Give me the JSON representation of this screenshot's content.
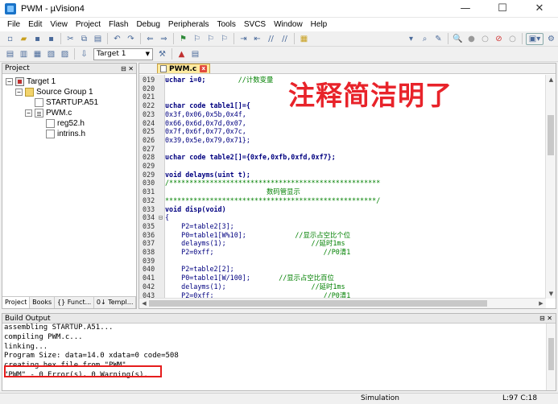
{
  "window": {
    "title": "PWM - µVision4",
    "controls": [
      "—",
      "☐",
      "✕"
    ]
  },
  "menu": [
    "File",
    "Edit",
    "View",
    "Project",
    "Flash",
    "Debug",
    "Peripherals",
    "Tools",
    "SVCS",
    "Window",
    "Help"
  ],
  "toolbar2": {
    "target_select": "Target 1"
  },
  "project_panel": {
    "title": "Project",
    "tree": [
      {
        "label": "Target 1",
        "level": 0,
        "type": "target",
        "expander": "−"
      },
      {
        "label": "Source Group 1",
        "level": 1,
        "type": "folder",
        "expander": "−"
      },
      {
        "label": "STARTUP.A51",
        "level": 2,
        "type": "file",
        "expander": ""
      },
      {
        "label": "PWM.c",
        "level": 2,
        "type": "cfile",
        "expander": "−"
      },
      {
        "label": "reg52.h",
        "level": 3,
        "type": "file",
        "expander": ""
      },
      {
        "label": "intrins.h",
        "level": 3,
        "type": "file",
        "expander": ""
      }
    ],
    "tabs": [
      "Project",
      "Books",
      "{} Funct...",
      "0↓ Templ..."
    ]
  },
  "editor": {
    "tab_label": "PWM.c",
    "lines": [
      {
        "n": "019",
        "fold": "",
        "code": "uchar i=0;        ",
        "comment": "//计数变量"
      },
      {
        "n": "020",
        "fold": "",
        "code": "",
        "comment": ""
      },
      {
        "n": "021",
        "fold": "",
        "code": "",
        "comment": ""
      },
      {
        "n": "022",
        "fold": "",
        "code": "uchar code table1[]={",
        "comment": ""
      },
      {
        "n": "023",
        "fold": "",
        "code": "0x3f,0x06,0x5b,0x4f,",
        "comment": ""
      },
      {
        "n": "024",
        "fold": "",
        "code": "0x66,0x6d,0x7d,0x07,",
        "comment": ""
      },
      {
        "n": "025",
        "fold": "",
        "code": "0x7f,0x6f,0x77,0x7c,",
        "comment": ""
      },
      {
        "n": "026",
        "fold": "",
        "code": "0x39,0x5e,0x79,0x71};",
        "comment": ""
      },
      {
        "n": "027",
        "fold": "",
        "code": "",
        "comment": ""
      },
      {
        "n": "028",
        "fold": "",
        "code": "uchar code table2[]={0xfe,0xfb,0xfd,0xf7};",
        "comment": ""
      },
      {
        "n": "029",
        "fold": "",
        "code": "",
        "comment": ""
      },
      {
        "n": "029",
        "fold": "",
        "code": "void delayms(uint t);",
        "comment": ""
      },
      {
        "n": "030",
        "fold": "",
        "code": "",
        "comment": "/****************************************************"
      },
      {
        "n": "031",
        "fold": "",
        "code": "",
        "comment": "                         数码管显示"
      },
      {
        "n": "032",
        "fold": "",
        "code": "",
        "comment": "****************************************************/"
      },
      {
        "n": "033",
        "fold": "",
        "code": "void disp(void)",
        "comment": ""
      },
      {
        "n": "034",
        "fold": "⊟",
        "code": "{",
        "comment": ""
      },
      {
        "n": "035",
        "fold": "",
        "code": "    P2=table2[3];",
        "comment": ""
      },
      {
        "n": "036",
        "fold": "",
        "code": "    P0=table1[W%10];            ",
        "comment": "//显示占空比个位"
      },
      {
        "n": "037",
        "fold": "",
        "code": "    delayms(1);                     ",
        "comment": "//延时1ms"
      },
      {
        "n": "038",
        "fold": "",
        "code": "    P2=0xff;                           ",
        "comment": "//P0清1"
      },
      {
        "n": "039",
        "fold": "",
        "code": "",
        "comment": ""
      },
      {
        "n": "040",
        "fold": "",
        "code": "    P2=table2[2];",
        "comment": ""
      },
      {
        "n": "041",
        "fold": "",
        "code": "    P0=table1[W/100];       ",
        "comment": "//显示占空比百位"
      },
      {
        "n": "042",
        "fold": "",
        "code": "    delayms(1);                     ",
        "comment": "//延时1ms"
      },
      {
        "n": "043",
        "fold": "",
        "code": "    P2=0xff;                           ",
        "comment": "//P0清1"
      },
      {
        "n": "044",
        "fold": "",
        "code": "",
        "comment": ""
      }
    ]
  },
  "annotation": {
    "text": "注释简洁明了",
    "color": "#e8232a"
  },
  "build_output": {
    "title": "Build Output",
    "lines": [
      "assembling STARTUP.A51...",
      "compiling PWM.c...",
      "linking...",
      "Program Size: data=14.0 xdata=0 code=508",
      "creating hex file from \"PWM\"...",
      "\"PWM\" - 0 Error(s), 0 Warning(s)."
    ]
  },
  "statusbar": {
    "mode": "Simulation",
    "position": "L:97 C:18"
  }
}
